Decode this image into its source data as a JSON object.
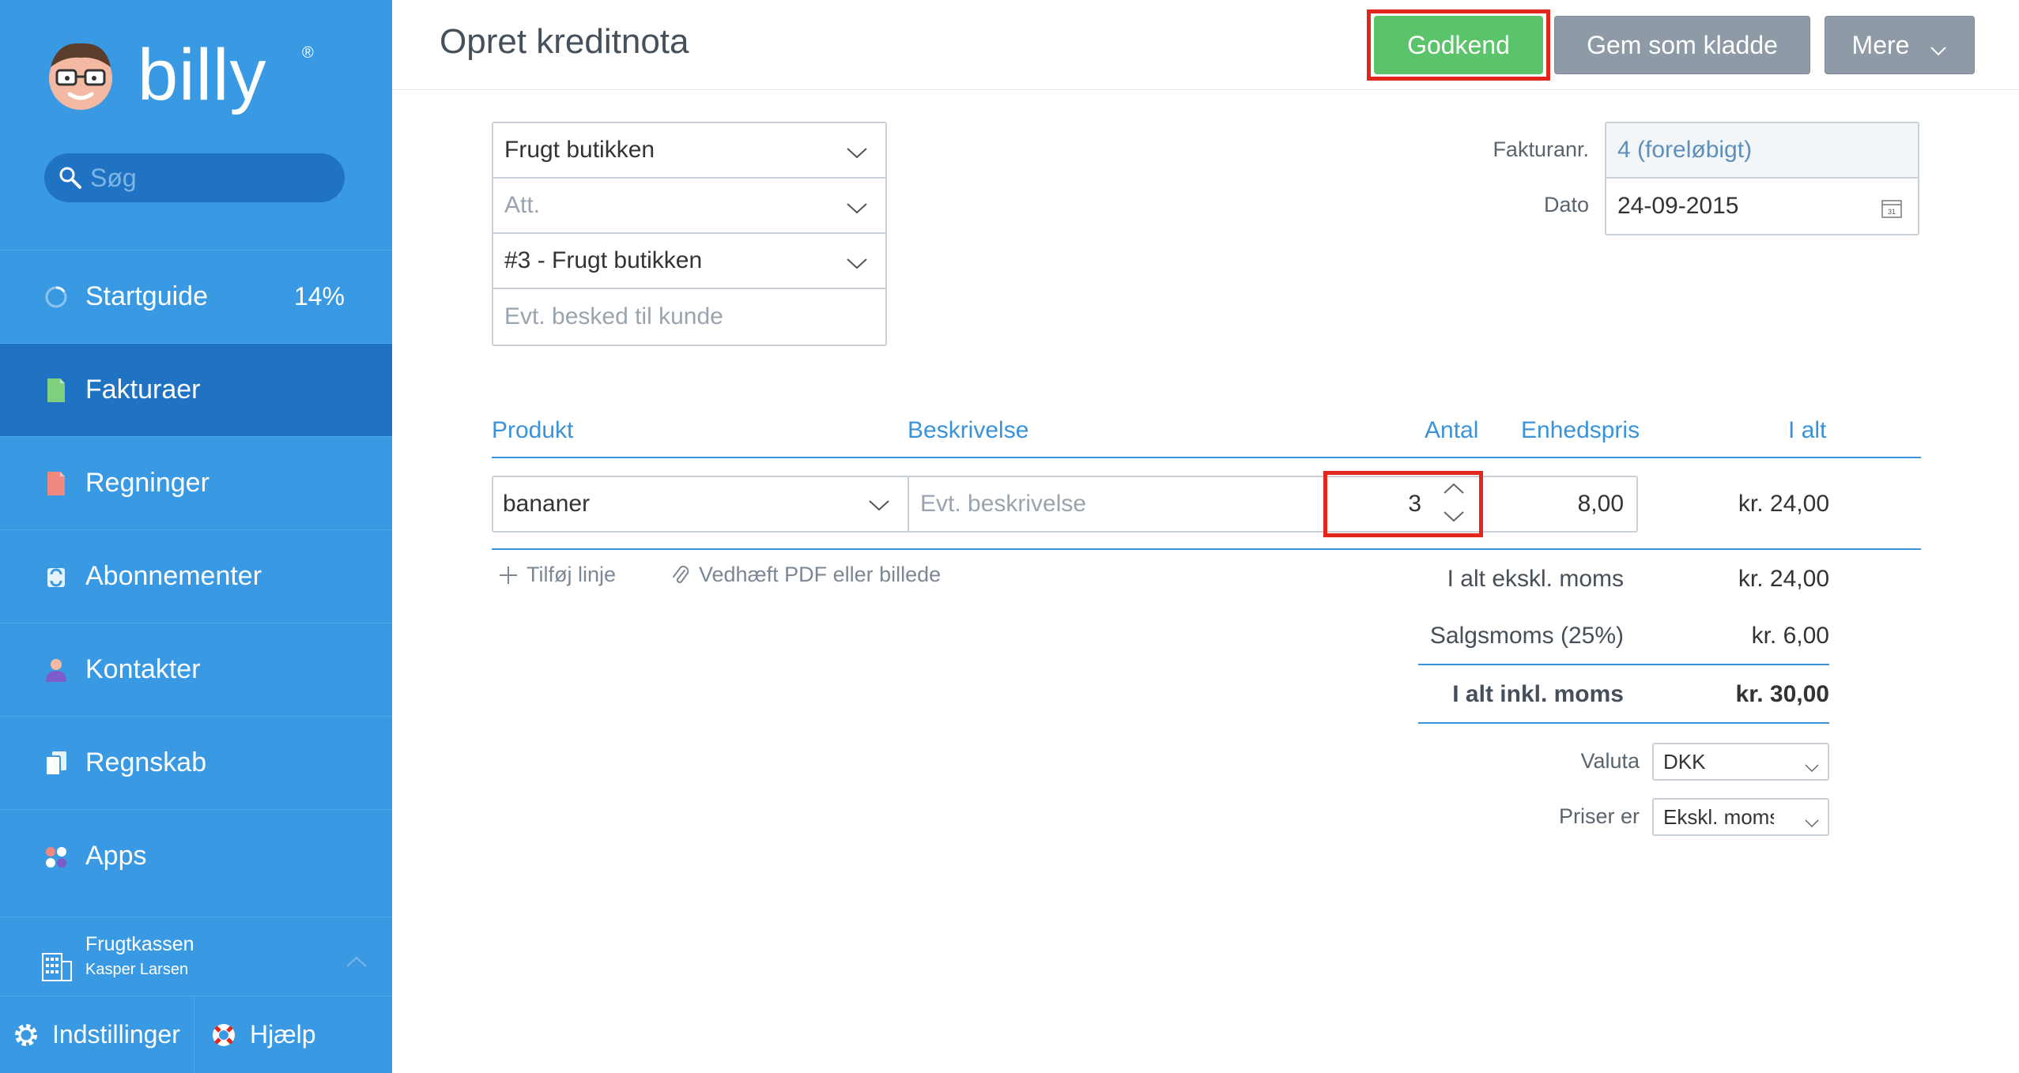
{
  "app": {
    "name": "billy",
    "registered": "®"
  },
  "colors": {
    "sidebar": "#3a99e3",
    "sidebar_active": "#1f73c2",
    "accent": "#3a92d8",
    "approve": "#5bc46a",
    "secondary_btn": "#8e9aa6",
    "highlight": "#e3261b"
  },
  "search": {
    "placeholder": "Søg"
  },
  "sidebar": {
    "items": [
      {
        "label": "Startguide",
        "icon": "progress-ring-icon",
        "progress": "14%"
      },
      {
        "label": "Fakturaer",
        "icon": "invoice-icon",
        "active": true
      },
      {
        "label": "Regninger",
        "icon": "bill-icon"
      },
      {
        "label": "Abonnementer",
        "icon": "subscription-icon"
      },
      {
        "label": "Kontakter",
        "icon": "person-icon"
      },
      {
        "label": "Regnskab",
        "icon": "accounting-icon"
      },
      {
        "label": "Apps",
        "icon": "apps-icon"
      }
    ],
    "organization": {
      "name": "Frugtkassen",
      "user": "Kasper Larsen"
    },
    "footer": {
      "settings": "Indstillinger",
      "help": "Hjælp"
    }
  },
  "header": {
    "title": "Opret kreditnota",
    "approve": "Godkend",
    "save_draft": "Gem som kladde",
    "more": "Mere"
  },
  "customer": {
    "contact": "Frugt butikken",
    "att_placeholder": "Att.",
    "address": "#3 - Frugt butikken",
    "message_placeholder": "Evt. besked til kunde"
  },
  "invoice": {
    "number_label": "Fakturanr.",
    "number": "4 (foreløbigt)",
    "date_label": "Dato",
    "date": "24-09-2015",
    "calendar_day": "31"
  },
  "lines": {
    "headers": {
      "product": "Produkt",
      "description": "Beskrivelse",
      "quantity": "Antal",
      "unit_price": "Enhedspris",
      "total": "I alt"
    },
    "rows": [
      {
        "product": "bananer",
        "description_placeholder": "Evt. beskrivelse",
        "quantity": "3",
        "unit_price": "8,00",
        "total": "kr. 24,00"
      }
    ],
    "add_line": "Tilføj linje",
    "attach": "Vedhæft PDF eller billede"
  },
  "totals": {
    "excl_label": "I alt ekskl. moms",
    "excl": "kr. 24,00",
    "vat_label": "Salgsmoms (25%)",
    "vat": "kr. 6,00",
    "incl_label": "I alt inkl. moms",
    "incl": "kr. 30,00"
  },
  "options": {
    "currency_label": "Valuta",
    "currency": "DKK",
    "prices_label": "Priser er",
    "prices": "Ekskl. moms"
  }
}
